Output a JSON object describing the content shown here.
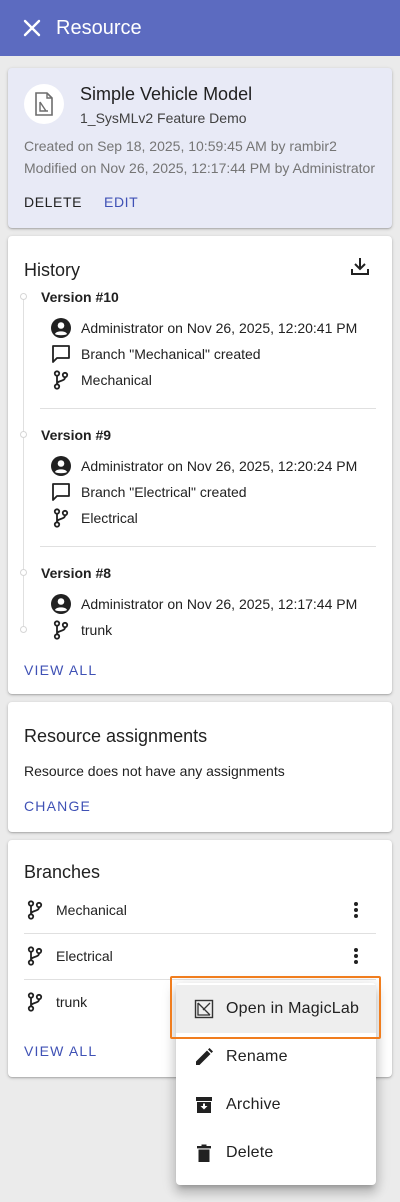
{
  "appbar": {
    "title": "Resource",
    "close_icon": "close-icon"
  },
  "resource": {
    "name": "Simple Vehicle Model",
    "project": "1_SysMLv2 Feature Demo",
    "created": "Created on Sep 18, 2025, 10:59:45 AM by rambir2",
    "modified": "Modified on Nov 26, 2025, 12:17:44 PM by Administrator",
    "delete_label": "DELETE",
    "edit_label": "EDIT",
    "icon": "model-file-icon"
  },
  "history": {
    "title": "History",
    "download_icon": "download-icon",
    "versions": [
      {
        "label": "Version #10",
        "author": "Administrator on Nov 26, 2025, 12:20:41 PM",
        "comment": "Branch \"Mechanical\" created",
        "branch": "Mechanical"
      },
      {
        "label": "Version #9",
        "author": "Administrator on Nov 26, 2025, 12:20:24 PM",
        "comment": "Branch \"Electrical\" created",
        "branch": "Electrical"
      },
      {
        "label": "Version #8",
        "author": "Administrator on Nov 26, 2025, 12:17:44 PM",
        "branch": "trunk"
      }
    ],
    "view_all_label": "VIEW ALL"
  },
  "assignments": {
    "title": "Resource assignments",
    "empty_text": "Resource does not have any assignments",
    "change_label": "CHANGE"
  },
  "branches": {
    "title": "Branches",
    "items": [
      {
        "name": "Mechanical"
      },
      {
        "name": "Electrical"
      },
      {
        "name": "trunk"
      }
    ],
    "view_all_label": "VIEW ALL"
  },
  "context_menu": {
    "items": [
      {
        "label": "Open in MagicLab",
        "icon": "magiclab-icon"
      },
      {
        "label": "Rename",
        "icon": "pencil-icon"
      },
      {
        "label": "Archive",
        "icon": "archive-icon"
      },
      {
        "label": "Delete",
        "icon": "trash-icon"
      }
    ]
  },
  "colors": {
    "appbar": "#5c6bc0",
    "resource_card_bg": "#e8eaf6",
    "link": "#3f51b5",
    "highlight_border": "#f07d1e"
  }
}
